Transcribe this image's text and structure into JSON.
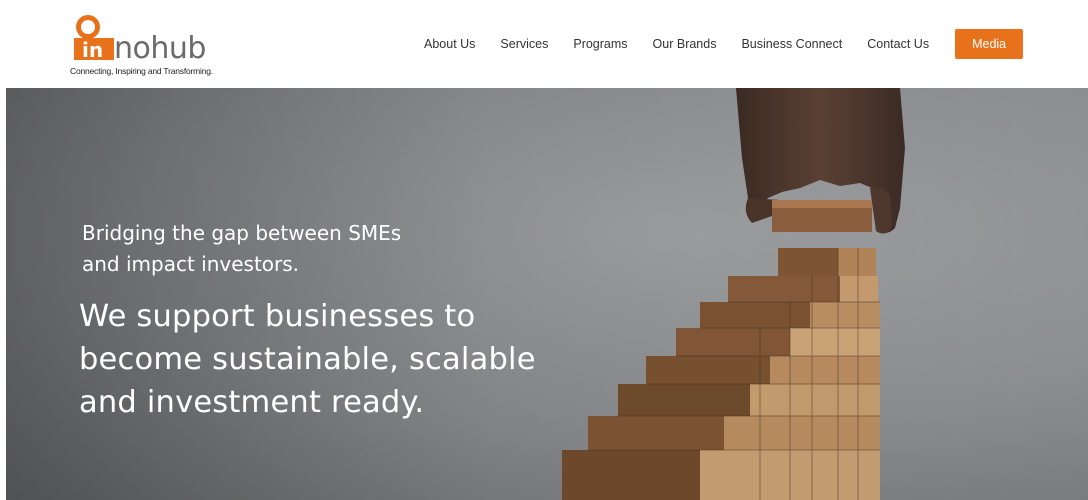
{
  "brand": {
    "logo_letters": "in",
    "logo_word": "nohub",
    "tagline": "Connecting, Inspiring and Transforming.",
    "accent_color": "#e8711b"
  },
  "nav": {
    "items": [
      {
        "label": "About Us"
      },
      {
        "label": "Services"
      },
      {
        "label": "Programs"
      },
      {
        "label": "Our Brands"
      },
      {
        "label": "Business Connect"
      },
      {
        "label": "Contact Us"
      }
    ],
    "cta_label": "Media"
  },
  "hero": {
    "subtitle": "Bridging the gap between SMEs and impact investors.",
    "title": "We support businesses to become sustainable, scalable and investment ready.",
    "image": "hand-placing-wooden-block-on-stair-stack"
  }
}
